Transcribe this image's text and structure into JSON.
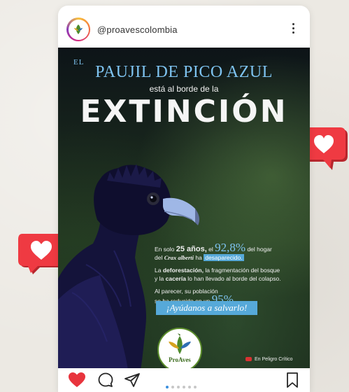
{
  "header": {
    "username": "@proavescolombia"
  },
  "post": {
    "title_prefix": "EL",
    "title_main": "PAUJIL DE PICO AZUL",
    "subtitle": "está al borde de la",
    "headline": "EXTINCIÓN",
    "fact1_a": "En solo",
    "fact1_years": "25 años,",
    "fact1_b": "el",
    "fact1_pct": "92,8%",
    "fact1_c": "del hogar",
    "fact1_d": "del",
    "fact1_species": "Crax alberti",
    "fact1_e": "ha",
    "fact1_highlight": "desaparecido.",
    "fact2_a": "La",
    "fact2_b1": "deforestación,",
    "fact2_c": "la fragmentación del bosque",
    "fact2_d": "y la",
    "fact2_b2": "cacería",
    "fact2_e": "lo han llevado al borde del colapso.",
    "fact3_a": "Al parecer, su población",
    "fact3_b": "se ha reducido en un",
    "fact3_pct": "95%",
    "cta": "¡Ayúdanos a salvarlo!",
    "logo_text": "ProAves",
    "status": "En Peligro Crítico"
  },
  "carousel": {
    "total": 6,
    "active": 0
  },
  "colors": {
    "accent_blue": "#56a9d9",
    "like_red": "#e8343d",
    "danger_red": "#d93232"
  }
}
